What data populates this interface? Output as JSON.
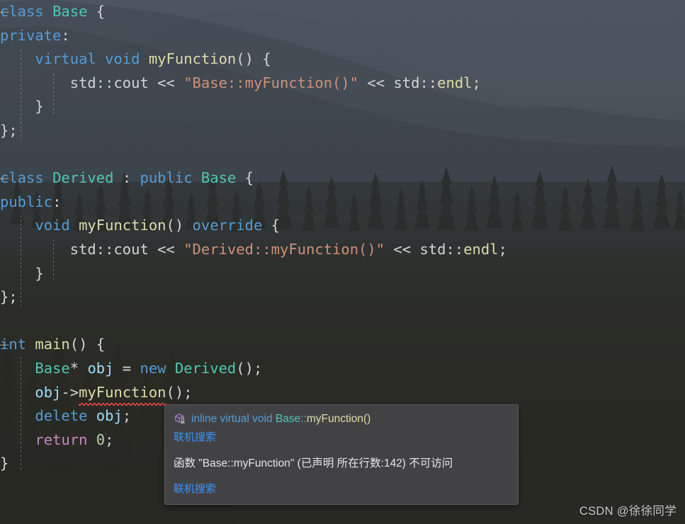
{
  "editor": {
    "language": "cpp",
    "font_size_px": 20,
    "code_lines": [
      {
        "indent": 0,
        "fold": "-",
        "tokens": [
          {
            "t": "class",
            "c": "key"
          },
          {
            "t": " ",
            "c": "plain"
          },
          {
            "t": "Base",
            "c": "type"
          },
          {
            "t": " {",
            "c": "plain"
          }
        ]
      },
      {
        "indent": 0,
        "tokens": [
          {
            "t": "private",
            "c": "key"
          },
          {
            "t": ":",
            "c": "plain"
          }
        ]
      },
      {
        "indent": 1,
        "tokens": [
          {
            "t": "virtual",
            "c": "key"
          },
          {
            "t": " ",
            "c": "plain"
          },
          {
            "t": "void",
            "c": "key"
          },
          {
            "t": " ",
            "c": "plain"
          },
          {
            "t": "myFunction",
            "c": "func"
          },
          {
            "t": "() {",
            "c": "plain"
          }
        ]
      },
      {
        "indent": 2,
        "tokens": [
          {
            "t": "std",
            "c": "plain"
          },
          {
            "t": "::",
            "c": "plain"
          },
          {
            "t": "cout",
            "c": "plain"
          },
          {
            "t": " << ",
            "c": "plain"
          },
          {
            "t": "\"Base::myFunction()\"",
            "c": "str"
          },
          {
            "t": " << ",
            "c": "plain"
          },
          {
            "t": "std",
            "c": "plain"
          },
          {
            "t": "::",
            "c": "plain"
          },
          {
            "t": "endl",
            "c": "func"
          },
          {
            "t": ";",
            "c": "plain"
          }
        ]
      },
      {
        "indent": 1,
        "tokens": [
          {
            "t": "}",
            "c": "plain"
          }
        ]
      },
      {
        "indent": 0,
        "tokens": [
          {
            "t": "};",
            "c": "plain"
          }
        ]
      },
      {
        "indent": 0,
        "tokens": []
      },
      {
        "indent": 0,
        "fold": "-",
        "tokens": [
          {
            "t": "class",
            "c": "key"
          },
          {
            "t": " ",
            "c": "plain"
          },
          {
            "t": "Derived",
            "c": "type"
          },
          {
            "t": " : ",
            "c": "plain"
          },
          {
            "t": "public",
            "c": "key"
          },
          {
            "t": " ",
            "c": "plain"
          },
          {
            "t": "Base",
            "c": "type"
          },
          {
            "t": " {",
            "c": "plain"
          }
        ]
      },
      {
        "indent": 0,
        "tokens": [
          {
            "t": "public",
            "c": "key"
          },
          {
            "t": ":",
            "c": "plain"
          }
        ]
      },
      {
        "indent": 1,
        "tokens": [
          {
            "t": "void",
            "c": "key"
          },
          {
            "t": " ",
            "c": "plain"
          },
          {
            "t": "myFunction",
            "c": "func"
          },
          {
            "t": "() ",
            "c": "plain"
          },
          {
            "t": "override",
            "c": "key"
          },
          {
            "t": " {",
            "c": "plain"
          }
        ]
      },
      {
        "indent": 2,
        "tokens": [
          {
            "t": "std",
            "c": "plain"
          },
          {
            "t": "::",
            "c": "plain"
          },
          {
            "t": "cout",
            "c": "plain"
          },
          {
            "t": " << ",
            "c": "plain"
          },
          {
            "t": "\"Derived::myFunction()\"",
            "c": "str"
          },
          {
            "t": " << ",
            "c": "plain"
          },
          {
            "t": "std",
            "c": "plain"
          },
          {
            "t": "::",
            "c": "plain"
          },
          {
            "t": "endl",
            "c": "func"
          },
          {
            "t": ";",
            "c": "plain"
          }
        ]
      },
      {
        "indent": 1,
        "tokens": [
          {
            "t": "}",
            "c": "plain"
          }
        ]
      },
      {
        "indent": 0,
        "tokens": [
          {
            "t": "};",
            "c": "plain"
          }
        ]
      },
      {
        "indent": 0,
        "tokens": []
      },
      {
        "indent": 0,
        "fold": "-",
        "tokens": [
          {
            "t": "int",
            "c": "key"
          },
          {
            "t": " ",
            "c": "plain"
          },
          {
            "t": "main",
            "c": "func"
          },
          {
            "t": "() {",
            "c": "plain"
          }
        ]
      },
      {
        "indent": 1,
        "tokens": [
          {
            "t": "Base",
            "c": "type"
          },
          {
            "t": "* ",
            "c": "plain"
          },
          {
            "t": "obj",
            "c": "var"
          },
          {
            "t": " = ",
            "c": "plain"
          },
          {
            "t": "new",
            "c": "key"
          },
          {
            "t": " ",
            "c": "plain"
          },
          {
            "t": "Derived",
            "c": "type"
          },
          {
            "t": "();",
            "c": "plain"
          }
        ]
      },
      {
        "indent": 1,
        "tokens": [
          {
            "t": "obj",
            "c": "var"
          },
          {
            "t": "->",
            "c": "plain"
          },
          {
            "t": "myFunction",
            "c": "func",
            "error": true
          },
          {
            "t": "();",
            "c": "plain"
          }
        ]
      },
      {
        "indent": 1,
        "tokens": [
          {
            "t": "delete",
            "c": "key"
          },
          {
            "t": " ",
            "c": "plain"
          },
          {
            "t": "obj",
            "c": "var"
          },
          {
            "t": ";",
            "c": "plain"
          }
        ]
      },
      {
        "indent": 1,
        "tokens": [
          {
            "t": "return",
            "c": "ctrl"
          },
          {
            "t": " ",
            "c": "plain"
          },
          {
            "t": "0",
            "c": "num"
          },
          {
            "t": ";",
            "c": "plain"
          }
        ]
      },
      {
        "indent": 0,
        "tokens": [
          {
            "t": "}",
            "c": "plain"
          }
        ]
      }
    ]
  },
  "tooltip": {
    "icon_name": "method-cube-icon",
    "badge_icon_name": "lock-icon",
    "signature_parts": [
      {
        "t": "inline virtual void ",
        "c": "key"
      },
      {
        "t": "Base",
        "c": "type"
      },
      {
        "t": "::",
        "c": "op"
      },
      {
        "t": "myFunction()",
        "c": "fn"
      }
    ],
    "signature_plain": "inline virtual void Base::myFunction()",
    "link_label_1": "联机搜索",
    "error_message": "函数 \"Base::myFunction\" (已声明 所在行数:142) 不可访问",
    "link_label_2": "联机搜索",
    "background_color": "#424245",
    "border_color": "#5a5a5e",
    "link_color": "#3794FF"
  },
  "watermark": {
    "text": "CSDN @徐徐同学"
  },
  "theme": {
    "keyword": "#569CD6",
    "control": "#C586C0",
    "type": "#4EC9B0",
    "function": "#DCDCAA",
    "variable": "#9CDCFE",
    "string": "#CE9178",
    "number": "#B5CEA8",
    "plain": "#D4D4D4",
    "error_squiggle": "#E5484D"
  }
}
